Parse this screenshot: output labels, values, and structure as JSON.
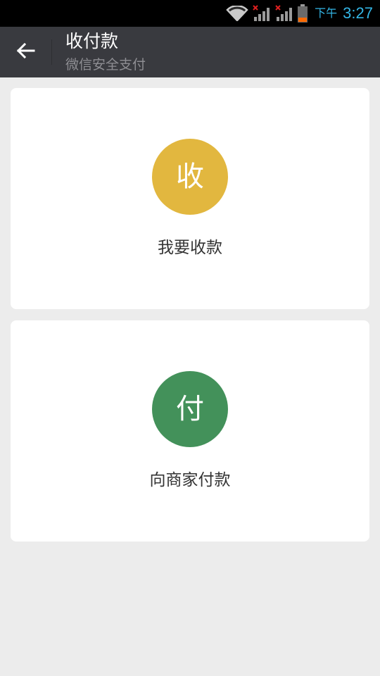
{
  "status_bar": {
    "ampm": "下午",
    "time": "3:27",
    "icons": [
      "wifi-icon",
      "signal-icon",
      "signal-icon",
      "battery-icon"
    ],
    "accent_color": "#33b5e5"
  },
  "app_bar": {
    "back_icon": "arrow-left-icon",
    "title": "收付款",
    "subtitle": "微信安全支付",
    "background_color": "#393a3f"
  },
  "cards": [
    {
      "icon_char": "收",
      "label": "我要收款",
      "icon_color": "#e2b73f"
    },
    {
      "icon_char": "付",
      "label": "向商家付款",
      "icon_color": "#43915a"
    }
  ]
}
